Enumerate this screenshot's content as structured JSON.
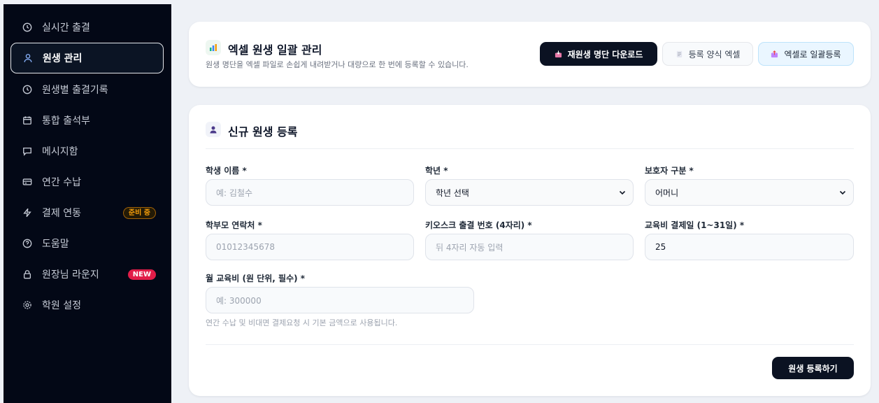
{
  "sidebar": {
    "items": [
      {
        "label": "실시간 출결",
        "icon": "clock-icon"
      },
      {
        "label": "원생 관리",
        "icon": "users-icon",
        "active": true
      },
      {
        "label": "원생별 출결기록",
        "icon": "clock-icon"
      },
      {
        "label": "통합 출석부",
        "icon": "calendar-icon"
      },
      {
        "label": "메시지함",
        "icon": "message-icon"
      },
      {
        "label": "연간 수납",
        "icon": "card-icon"
      },
      {
        "label": "결제 연동",
        "icon": "bolt-icon",
        "badge": "준비 중"
      },
      {
        "label": "도움말",
        "icon": "help-icon"
      },
      {
        "label": "원장님 라운지",
        "icon": "lock-icon",
        "badge": "NEW"
      },
      {
        "label": "학원 설정",
        "icon": "gear-icon"
      }
    ]
  },
  "excel_card": {
    "title": "엑셀 원생 일괄 관리",
    "description": "원생 명단을 엑셀 파일로 손쉽게 내려받거나 대량으로 한 번에 등록할 수 있습니다.",
    "download_button": "재원생 명단 다운로드",
    "template_button": "등록 양식 엑셀",
    "upload_button": "엑셀로 일괄등록"
  },
  "register_card": {
    "title": "신규 원생 등록",
    "fields": {
      "student_name": {
        "label": "학생 이름 *",
        "placeholder": "예: 김철수"
      },
      "grade": {
        "label": "학년 *",
        "value": "학년 선택"
      },
      "guardian_type": {
        "label": "보호자 구분 *",
        "value": "어머니"
      },
      "parent_phone": {
        "label": "학부모 연락처 *",
        "placeholder": "01012345678"
      },
      "kiosk_number": {
        "label": "키오스크 출결 번호 (4자리) *",
        "placeholder": "뒤 4자리 자동 입력"
      },
      "payment_day": {
        "label": "교육비 결제일 (1~31일) *",
        "value": "25"
      },
      "monthly_fee": {
        "label": "월 교육비 (원 단위, 필수) *",
        "placeholder": "예: 300000"
      }
    },
    "fee_hint": "연간 수납 및 비대면 결제요청 시 기본 금액으로 사용됩니다.",
    "submit_button": "원생 등록하기"
  },
  "colors": {
    "sidebar_bg": "#030816",
    "primary": "#0b1222",
    "badge_new": "#e11d48",
    "badge_prep": "#f59e0b"
  }
}
